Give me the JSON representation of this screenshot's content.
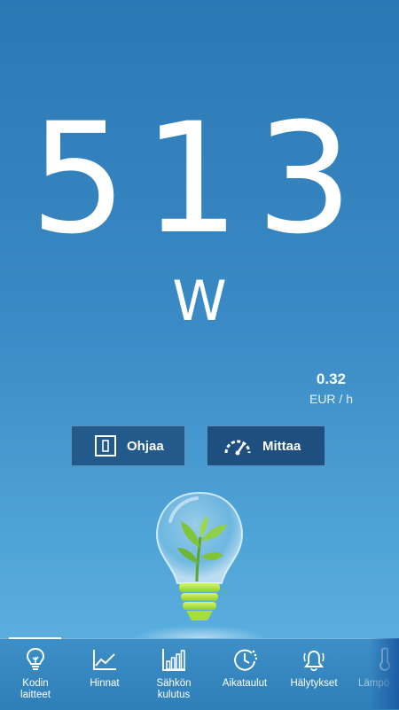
{
  "meter": {
    "power_value": "513",
    "power_unit": "W",
    "cost_value": "0.32",
    "cost_unit": "EUR / h"
  },
  "buttons": {
    "control_label": "Ohjaa",
    "measure_label": "Mittaa"
  },
  "tabs": [
    {
      "label_line1": "Kodin",
      "label_line2": "laitteet",
      "icon": "lightbulb-icon",
      "selected": true
    },
    {
      "label_line1": "Hinnat",
      "label_line2": "",
      "icon": "line-chart-icon",
      "selected": false
    },
    {
      "label_line1": "Sähkön",
      "label_line2": "kulutus",
      "icon": "bar-chart-icon",
      "selected": false
    },
    {
      "label_line1": "Aikataulut",
      "label_line2": "",
      "icon": "clock-icon",
      "selected": false
    },
    {
      "label_line1": "Hälytykset",
      "label_line2": "",
      "icon": "alarm-bell-icon",
      "selected": false
    },
    {
      "label_line1": "Lämpö",
      "label_line2": "",
      "icon": "thermometer-icon",
      "selected": false
    }
  ],
  "colors": {
    "background_top": "#2b78b4",
    "background_bottom": "#63b6e4",
    "button_bg": "#235a8c",
    "text": "#ffffff",
    "leaf_green": "#7fc43a"
  }
}
